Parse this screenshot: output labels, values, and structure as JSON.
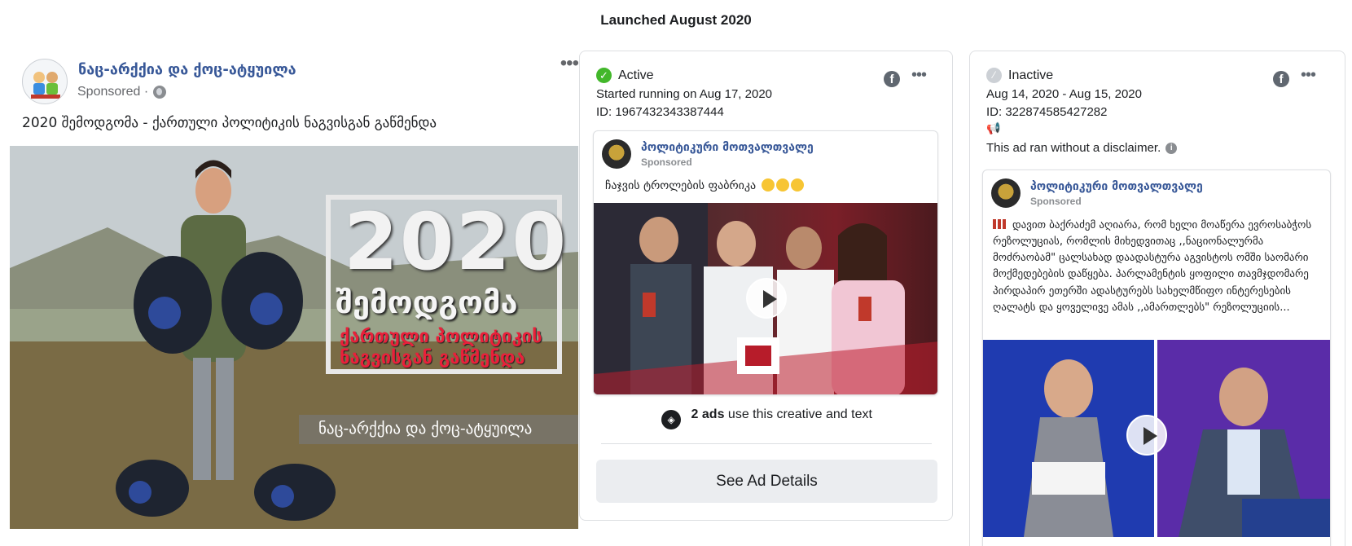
{
  "heading": "Launched August 2020",
  "left_post": {
    "page_name": "ნაც-არქქია და ქოც-ატყუილა",
    "sponsored": "Sponsored ·",
    "text": "2020 შემოდგომა - ქართული პოლიტიკის ნაგვისგან გაწმენდა",
    "image_big": "2020",
    "image_sub1": "შემოდგომა",
    "image_sub2": "ქართული პოლიტიკის ნაგვისგან გაწმენდა",
    "watermark": "ნაც-არქქია და ქოც-ატყუილა"
  },
  "ads": [
    {
      "status": "Active",
      "line1": "Started running on Aug 17, 2020",
      "line2": "ID: 1967432343387444",
      "page_name": "პოლიტიკური მოთვალთვალე",
      "sponsored": "Sponsored",
      "text": "ჩაჯვის ტროლების ფაბრიკა",
      "uses_count": "2 ads",
      "uses_text": "use this creative and text",
      "button": "See Ad Details"
    },
    {
      "status": "Inactive",
      "line1": "Aug 14, 2020 - Aug 15, 2020",
      "line2": "ID: 322874585427282",
      "disclaimer": "This ad ran without a disclaimer.",
      "page_name": "პოლიტიკური მოთვალთვალე",
      "sponsored": "Sponsored",
      "text": "დავით ბაქრაძემ აღიარა, რომ ხელი მოაწერა ევროსაბჭოს რეზოლუციას, რომლის მიხედვითაც ,,ნაციონალურმა მოძრაობამ\" ცალსახად დაადასტურა აგვისტოს ომში საომარი მოქმედებების დაწყება. პარლამენტის ყოფილი თავმჯდომარე პირდაპირ ეთერში ადასტურებს სახელმწიფო ინტერესების ღალატს და ყოველივე ამას ,,ამართლებს\" რეზოლუციის..."
    }
  ],
  "icons": {
    "facebook": "facebook-icon",
    "more": "more-icon",
    "play": "play-icon"
  },
  "colors": {
    "active": "#42b72a",
    "link": "#385898"
  }
}
